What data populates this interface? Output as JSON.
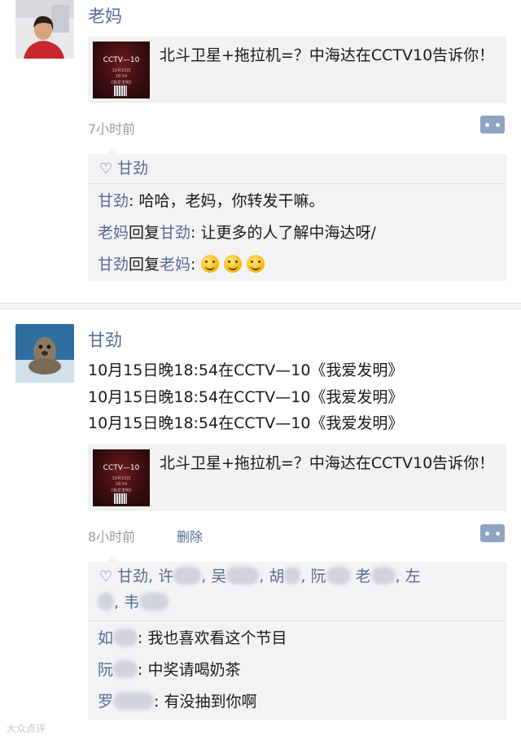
{
  "posts": [
    {
      "author": "老妈",
      "share": {
        "text": "北斗卫星+拖拉机=？中海达在CCTV10告诉你！",
        "thumb_title": "CCTV—10",
        "thumb_sub": "10月15日",
        "thumb_time": "18:54",
        "thumb_show": "《我爱发明》"
      },
      "time": "7小时前",
      "likes": "甘劲",
      "comments": [
        {
          "name": "甘劲",
          "sep": ": ",
          "text": "哈哈，老妈，你转发干嘛。"
        },
        {
          "name": "老妈",
          "reply_word": "回复",
          "reply_to": "甘劲",
          "sep": ": ",
          "text": "让更多的人了解中海达呀/"
        },
        {
          "name": "甘劲",
          "reply_word": "回复",
          "reply_to": "老妈",
          "sep": ": ",
          "emoji_count": 3
        }
      ]
    },
    {
      "author": "甘劲",
      "body_lines": [
        "10月15日晚18:54在CCTV—10《我爱发明》",
        "10月15日晚18:54在CCTV—10《我爱发明》",
        "10月15日晚18:54在CCTV—10《我爱发明》"
      ],
      "share": {
        "text": "北斗卫星+拖拉机=？中海达在CCTV10告诉你！",
        "thumb_title": "CCTV—10",
        "thumb_sub": "10月15日",
        "thumb_time": "18:54",
        "thumb_show": "《我爱发明》"
      },
      "time": "8小时前",
      "delete_label": "删除",
      "likes_line1": [
        "甘劲,",
        "许",
        "吴",
        "胡",
        "阮",
        "老",
        ", 左"
      ],
      "likes_line2": [
        "韦"
      ],
      "comments": [
        {
          "name": "如",
          "sep": ": ",
          "text": "我也喜欢看这个节目"
        },
        {
          "name": "阮",
          "sep": ": ",
          "text": "中奖请喝奶茶"
        },
        {
          "name": "罗",
          "sep": ": ",
          "text": "有没抽到你啊"
        }
      ]
    }
  ],
  "watermark": "大众点评",
  "colors": {
    "link": "#576b95",
    "time": "#9b9b9b",
    "comment_bg": "#f3f3f5",
    "card_bg": "#f2f2f2"
  }
}
